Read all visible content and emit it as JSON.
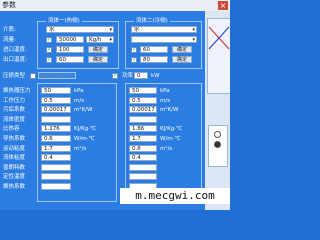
{
  "window": {
    "title": "参数",
    "close_icon": "close-icon"
  },
  "group_left": {
    "title": "流体一(热侧)",
    "fluid_name": "水",
    "flow_value": "50000",
    "flow_unit": "Kg/h",
    "inlet_temp": "100",
    "outlet_temp": "60",
    "btn_label": "确定"
  },
  "group_right": {
    "title": "流体二(冷侧)",
    "fluid_name": "水",
    "flow_value": "",
    "inlet_temp": "60",
    "outlet_temp": "80",
    "btn_label": "确定"
  },
  "row_labels": {
    "fluid": "介质:",
    "flow": "流量:",
    "inlet": "进口温度:",
    "outlet": "出口温度:"
  },
  "middle": {
    "label_a": "压损类型",
    "value_a": "1000 Pa",
    "label_b": "功率",
    "value_b": "0",
    "unit_b": "kW"
  },
  "props_left": {
    "rows": [
      {
        "label": "换热器压力",
        "value": "50",
        "unit": "kPa"
      },
      {
        "label": "工作压力",
        "value": "0.5",
        "unit": "m/s"
      },
      {
        "label": "污垢系数",
        "value": "0.00017",
        "unit": "m²K/W"
      },
      {
        "label": "流体密度",
        "value": "",
        "unit": ""
      },
      {
        "label": "比热容",
        "value": "1.176",
        "unit": "KJ/Kg·℃"
      },
      {
        "label": "导热系数",
        "value": "0.6",
        "unit": "W/m·℃"
      },
      {
        "label": "运动粘度",
        "value": "1.7",
        "unit": "m²/s"
      },
      {
        "label": "流体粘度",
        "value": "0.4",
        "unit": ""
      },
      {
        "label": "普朗特数",
        "value": "",
        "unit": ""
      },
      {
        "label": "定性温度",
        "value": "",
        "unit": ""
      },
      {
        "label": "换热系数",
        "value": "",
        "unit": ""
      }
    ]
  },
  "props_right": {
    "rows": [
      {
        "value": "50",
        "unit": "kPa"
      },
      {
        "value": "0.5",
        "unit": "m/s"
      },
      {
        "value": "0.00017",
        "unit": "m²K/W"
      },
      {
        "value": "",
        "unit": ""
      },
      {
        "value": "1.86",
        "unit": "KJ/Kg·℃"
      },
      {
        "value": "1.7",
        "unit": "W/m·℃"
      },
      {
        "value": "0.6",
        "unit": "m²/s"
      },
      {
        "value": "0.4",
        "unit": ""
      },
      {
        "value": "",
        "unit": ""
      },
      {
        "value": "",
        "unit": ""
      },
      {
        "value": "",
        "unit": ""
      }
    ]
  },
  "watermark": "m.mecgwi.com"
}
